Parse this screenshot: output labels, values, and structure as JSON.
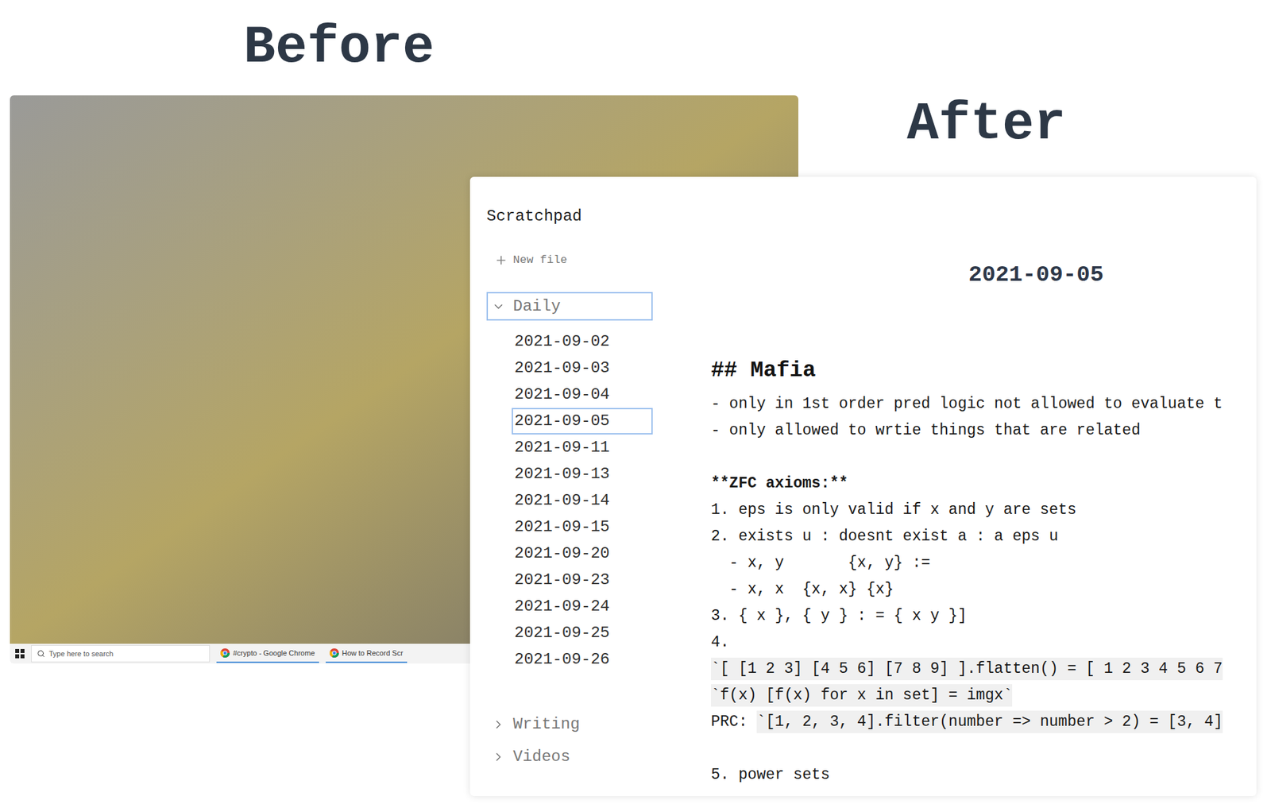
{
  "captions": {
    "before": "Before",
    "after": "After"
  },
  "desktop": {
    "taskbar": {
      "search_placeholder": "Type here to search",
      "tasks": [
        {
          "label": "#crypto - Google Chrome"
        },
        {
          "label": "How to Record Scr"
        }
      ]
    }
  },
  "app": {
    "title": "Scratchpad",
    "new_file": "New file",
    "folders": [
      {
        "name": "Daily",
        "expanded": true,
        "selected": true,
        "files": [
          {
            "name": "2021-09-02",
            "selected": false
          },
          {
            "name": "2021-09-03",
            "selected": false
          },
          {
            "name": "2021-09-04",
            "selected": false
          },
          {
            "name": "2021-09-05",
            "selected": true
          },
          {
            "name": "2021-09-11",
            "selected": false
          },
          {
            "name": "2021-09-13",
            "selected": false
          },
          {
            "name": "2021-09-14",
            "selected": false
          },
          {
            "name": "2021-09-15",
            "selected": false
          },
          {
            "name": "2021-09-20",
            "selected": false
          },
          {
            "name": "2021-09-23",
            "selected": false
          },
          {
            "name": "2021-09-24",
            "selected": false
          },
          {
            "name": "2021-09-25",
            "selected": false
          },
          {
            "name": "2021-09-26",
            "selected": false
          }
        ]
      },
      {
        "name": "Writing",
        "expanded": false,
        "selected": false,
        "files": []
      },
      {
        "name": "Videos",
        "expanded": false,
        "selected": false,
        "files": []
      }
    ]
  },
  "document": {
    "title": "2021-09-05",
    "lines": [
      {
        "kind": "heading",
        "text": "## Mafia"
      },
      {
        "kind": "text",
        "text": "- only in 1st order pred logic not allowed to evaluate t"
      },
      {
        "kind": "text",
        "text": "- only allowed to wrtie things that are related"
      },
      {
        "kind": "blank",
        "text": ""
      },
      {
        "kind": "bold",
        "text": "**ZFC axioms:**"
      },
      {
        "kind": "text",
        "text": "1. eps is only valid if x and y are sets"
      },
      {
        "kind": "text",
        "text": "2. exists u : doesnt exist a : a eps u"
      },
      {
        "kind": "text",
        "text": "  - x, y       {x, y} :="
      },
      {
        "kind": "text",
        "text": "  - x, x  {x, x} {x}"
      },
      {
        "kind": "text",
        "text": "3. { x }, { y } : = { x y }]"
      },
      {
        "kind": "text",
        "text": "4."
      },
      {
        "kind": "code",
        "text": "`[ [1 2 3] [4 5 6] [7 8 9] ].flatten() = [ 1 2 3 4 5 6 7"
      },
      {
        "kind": "code",
        "text": "`f(x) [f(x) for x in set] = imgx`"
      },
      {
        "kind": "mixed",
        "text": "PRC: ",
        "code": "`[1, 2, 3, 4].filter(number => number > 2) = [3, 4]"
      },
      {
        "kind": "blank",
        "text": ""
      },
      {
        "kind": "text",
        "text": "5. power sets"
      }
    ]
  }
}
